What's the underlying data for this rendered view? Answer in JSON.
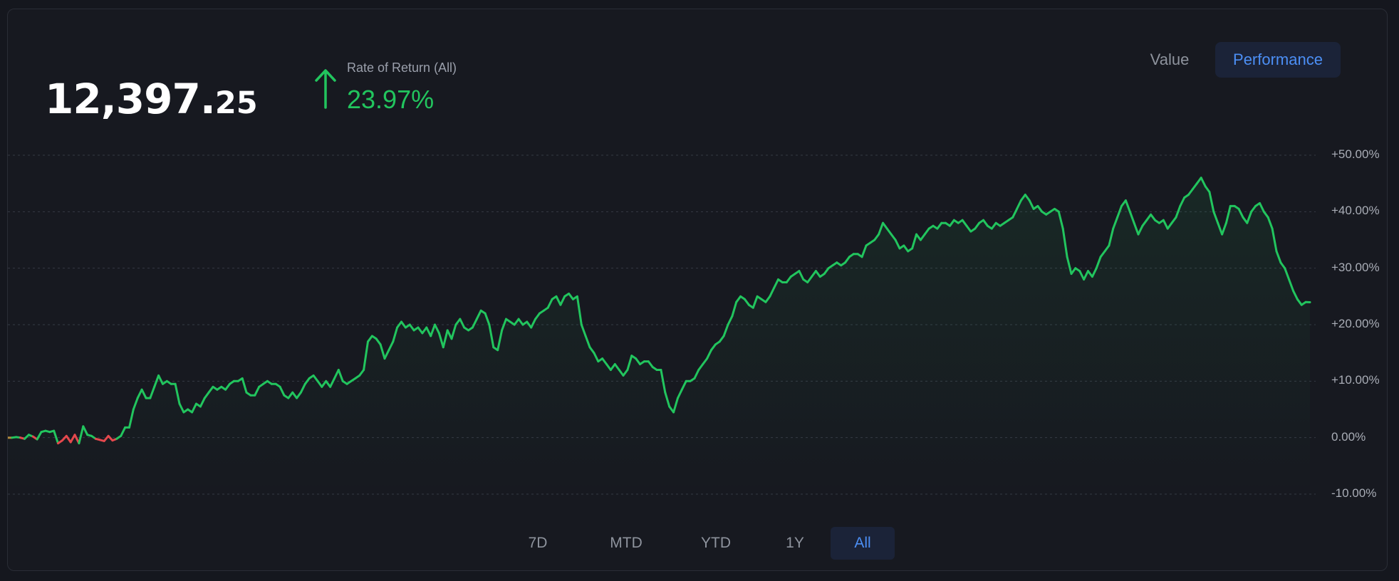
{
  "header": {
    "value_integer": "12,397.",
    "value_decimal": "25",
    "return_label": "Rate of Return (All)",
    "return_value": "23.97%"
  },
  "view_toggle": {
    "options": [
      "Value",
      "Performance"
    ],
    "selected": "Performance"
  },
  "ranges": {
    "options": [
      "7D",
      "MTD",
      "YTD",
      "1Y",
      "All"
    ],
    "selected": "All"
  },
  "colors": {
    "positive": "#22c55e",
    "negative": "#e5484d",
    "accent": "#4c8ff5",
    "background": "#171920"
  },
  "chart_data": {
    "type": "line",
    "title": "",
    "xlabel": "",
    "ylabel": "",
    "ylim": [
      -10,
      50
    ],
    "ytick_labels": [
      "+50.00%",
      "+40.00%",
      "+30.00%",
      "+20.00%",
      "+10.00%",
      "0.00%",
      "-10.00%"
    ],
    "yticks": [
      50,
      40,
      30,
      20,
      10,
      0,
      -10
    ],
    "grid": true,
    "legend": "none",
    "series": [
      {
        "values": [
          0,
          0,
          0.1,
          0,
          -0.2,
          0.5,
          0.2,
          -0.3,
          1,
          1.2,
          1,
          1.2,
          -1,
          -0.5,
          0.3,
          -0.8,
          0.5,
          -1,
          2,
          0.5,
          0.3,
          -0.2,
          -0.4,
          -0.6,
          0.3,
          -0.5,
          -0.2,
          0.3,
          1.8,
          1.8,
          5,
          7,
          8.5,
          7,
          7,
          9,
          11,
          9.5,
          10,
          9.5,
          9.5,
          6,
          4.5,
          5,
          4.5,
          6,
          5.5,
          7,
          8,
          9,
          8.5,
          9,
          8.5,
          9.5,
          10,
          10,
          10.5,
          8,
          7.5,
          7.5,
          9,
          9.5,
          10,
          9.5,
          9.5,
          9,
          7.5,
          7,
          8,
          7,
          8,
          9.5,
          10.5,
          11,
          10,
          9,
          10,
          9,
          10.5,
          12,
          10,
          9.5,
          10,
          10.5,
          11,
          12,
          17,
          18,
          17.5,
          16.5,
          14,
          15.5,
          17,
          19.5,
          20.5,
          19.5,
          20,
          19,
          19.5,
          18.5,
          19.5,
          18,
          20,
          18.5,
          16,
          19,
          17.5,
          20,
          21,
          19.5,
          19,
          19.5,
          21,
          22.5,
          22,
          20,
          16,
          15.5,
          19,
          21,
          20.5,
          20,
          21,
          20,
          20.5,
          19.5,
          21,
          22,
          22.5,
          23,
          24.5,
          25,
          23.5,
          25,
          25.5,
          24.5,
          25,
          20,
          18,
          16,
          15,
          13.5,
          14,
          13,
          12,
          13,
          12,
          11,
          12,
          14.5,
          14,
          13,
          13.5,
          13.5,
          12.5,
          12,
          12,
          8,
          5.5,
          4.5,
          7,
          8.5,
          10,
          10,
          10.5,
          12,
          13,
          14,
          15.5,
          16.5,
          17,
          18,
          20,
          21.5,
          24,
          25,
          24.5,
          23.5,
          23,
          25,
          24.5,
          24,
          25,
          26.5,
          28,
          27.5,
          27.5,
          28.5,
          29,
          29.5,
          28,
          27.5,
          28.5,
          29.5,
          28.5,
          29,
          30,
          30.5,
          31,
          30.5,
          31,
          32,
          32.5,
          32.5,
          32,
          34,
          34.5,
          35,
          36,
          38,
          37,
          36,
          35,
          33.5,
          34,
          33,
          33.5,
          36,
          35,
          36,
          37,
          37.5,
          37,
          38,
          38,
          37.5,
          38.5,
          38,
          38.5,
          37.5,
          36.5,
          37,
          38,
          38.5,
          37.5,
          37,
          38,
          37.5,
          38,
          38.5,
          39,
          40.5,
          42,
          43,
          42,
          40.5,
          41,
          40,
          39.5,
          40,
          40.5,
          40,
          37,
          32,
          29,
          30,
          29.5,
          28,
          29.5,
          28.5,
          30,
          32,
          33,
          34,
          37,
          39,
          41,
          42,
          40,
          38,
          36,
          37.5,
          38.5,
          39.5,
          38.5,
          38,
          38.5,
          37,
          38,
          39,
          41,
          42.5,
          43,
          44,
          45,
          46,
          44.5,
          43.5,
          40,
          38,
          36,
          38,
          41,
          41,
          40.5,
          39,
          38,
          40,
          41,
          41.5,
          40,
          39,
          37,
          33,
          31,
          30,
          28,
          26,
          24.5,
          23.5,
          24,
          23.97
        ]
      }
    ]
  }
}
